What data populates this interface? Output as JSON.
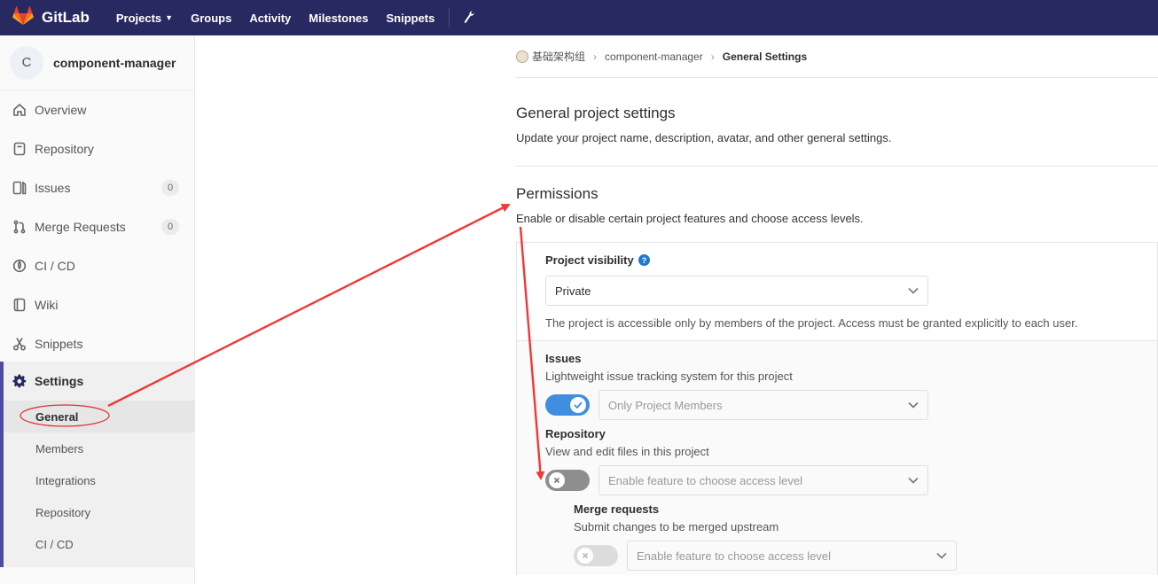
{
  "navbar": {
    "brand": "GitLab",
    "links": [
      {
        "label": "Projects",
        "has_caret": true
      },
      {
        "label": "Groups"
      },
      {
        "label": "Activity"
      },
      {
        "label": "Milestones"
      },
      {
        "label": "Snippets"
      }
    ],
    "icons": {
      "logo": "gitlab-tanuki-logo",
      "admin": "wrench-icon"
    },
    "bg_color": "#292961"
  },
  "sidebar": {
    "project_avatar_letter": "C",
    "project_name": "component-manager",
    "items": [
      {
        "label": "Overview",
        "icon": "home-icon"
      },
      {
        "label": "Repository",
        "icon": "doc-icon"
      },
      {
        "label": "Issues",
        "icon": "issues-icon",
        "badge": "0"
      },
      {
        "label": "Merge Requests",
        "icon": "merge-request-icon",
        "badge": "0"
      },
      {
        "label": "CI / CD",
        "icon": "rocket-icon"
      },
      {
        "label": "Wiki",
        "icon": "book-icon"
      },
      {
        "label": "Snippets",
        "icon": "scissors-icon"
      },
      {
        "label": "Settings",
        "icon": "gear-icon",
        "active": true
      }
    ],
    "settings_sub": [
      "General",
      "Members",
      "Integrations",
      "Repository",
      "CI / CD"
    ],
    "active_sub": "General"
  },
  "breadcrumb": {
    "group": "基础架构组",
    "project": "component-manager",
    "current": "General Settings"
  },
  "general": {
    "title": "General project settings",
    "description": "Update your project name, description, avatar, and other general settings."
  },
  "permissions": {
    "title": "Permissions",
    "description": "Enable or disable certain project features and choose access levels.",
    "visibility_label": "Project visibility",
    "visibility_value": "Private",
    "visibility_help": "The project is accessible only by members of the project. Access must be granted explicitly to each user.",
    "features": [
      {
        "name": "Issues",
        "description": "Lightweight issue tracking system for this project",
        "enabled": true,
        "access": "Only Project Members"
      },
      {
        "name": "Repository",
        "description": "View and edit files in this project",
        "enabled": false,
        "access": "Enable feature to choose access level"
      },
      {
        "name": "Merge requests",
        "description": "Submit changes to be merged upstream",
        "enabled": false,
        "access": "Enable feature to choose access level",
        "nested": true
      }
    ]
  },
  "colors": {
    "accent": "#3f8ee0",
    "annotation": "#f03838",
    "sidebar_active": "#4b4ba3"
  }
}
